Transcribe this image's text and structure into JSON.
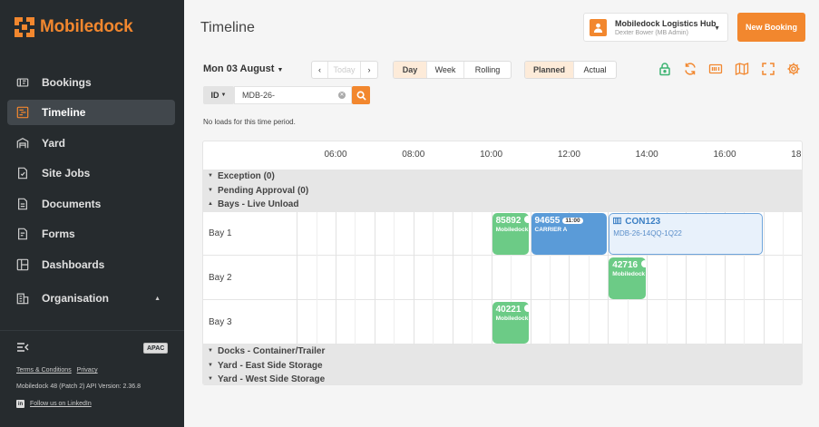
{
  "app": {
    "brand": "Mobiledock",
    "accent_color": "#f2872e",
    "sidebar_color": "#262b2e"
  },
  "sidebar": {
    "items": [
      {
        "label": "Bookings",
        "icon": "ticket-icon"
      },
      {
        "label": "Timeline",
        "icon": "timeline-icon",
        "active": true
      },
      {
        "label": "Yard",
        "icon": "warehouse-icon"
      },
      {
        "label": "Site Jobs",
        "icon": "site-job-icon"
      },
      {
        "label": "Documents",
        "icon": "document-icon"
      },
      {
        "label": "Forms",
        "icon": "form-icon"
      },
      {
        "label": "Dashboards",
        "icon": "dashboard-icon"
      },
      {
        "label": "Organisation",
        "icon": "building-icon",
        "expanded": true
      }
    ],
    "region_badge": "APAC",
    "terms_label": "Terms & Conditions",
    "privacy_label": "Privacy",
    "version_text": "Mobiledock 48 (Patch 2)  API Version: 2.36.8",
    "linkedin_label": "Follow us on LinkedIn"
  },
  "header": {
    "title": "Timeline",
    "hub_name": "Mobiledock Logistics Hub",
    "hub_user": "Dexter Bower (MB Admin)",
    "new_booking_label": "New Booking"
  },
  "toolbar": {
    "date_label": "Mon 03 August",
    "today_label": "Today",
    "view_options": [
      "Day",
      "Week",
      "Rolling"
    ],
    "selected_view": "Day",
    "mode_options": [
      "Planned",
      "Actual"
    ],
    "selected_mode": "Planned",
    "icons": [
      "lock-icon",
      "refresh-icon",
      "barcode-icon",
      "map-icon",
      "fullscreen-icon",
      "settings-icon"
    ]
  },
  "search": {
    "field_label": "ID",
    "value": "MDB-26-"
  },
  "status_message": "No loads for this time period.",
  "timeline": {
    "ticks": [
      "06:00",
      "08:00",
      "10:00",
      "12:00",
      "14:00",
      "16:00",
      "18:00"
    ],
    "groups_top": [
      {
        "label": "Exception (0)",
        "expanded": false
      },
      {
        "label": "Pending Approval (0)",
        "expanded": false
      },
      {
        "label": "Bays - Live Unload",
        "expanded": true
      }
    ],
    "bays": [
      "Bay 1",
      "Bay 2",
      "Bay 3"
    ],
    "groups_bottom": [
      {
        "label": "Docks - Container/Trailer",
        "expanded": false
      },
      {
        "label": "Yard - East Side Storage",
        "expanded": false
      },
      {
        "label": "Yard - West Side Storage",
        "expanded": false
      }
    ],
    "bookings": [
      {
        "id": "85892",
        "sub": "Mobiledock",
        "bay": 1,
        "start": "10:00",
        "end": "11:00",
        "status": "green"
      },
      {
        "id": "94655",
        "time": "11:00",
        "sub": "CARRIER A",
        "bay": 1,
        "start": "11:00",
        "end": "13:00",
        "status": "blue"
      },
      {
        "id": "CON123",
        "sub": "MDB-26-14QQ-1Q22",
        "bay": 1,
        "start": "13:00",
        "end": "17:00",
        "status": "light",
        "icon": "container-icon"
      },
      {
        "id": "42716",
        "sub": "Mobiledock",
        "bay": 2,
        "start": "13:00",
        "end": "14:00",
        "status": "green"
      },
      {
        "id": "40221",
        "sub": "Mobiledock",
        "bay": 3,
        "start": "10:00",
        "end": "11:00",
        "status": "green"
      }
    ]
  }
}
